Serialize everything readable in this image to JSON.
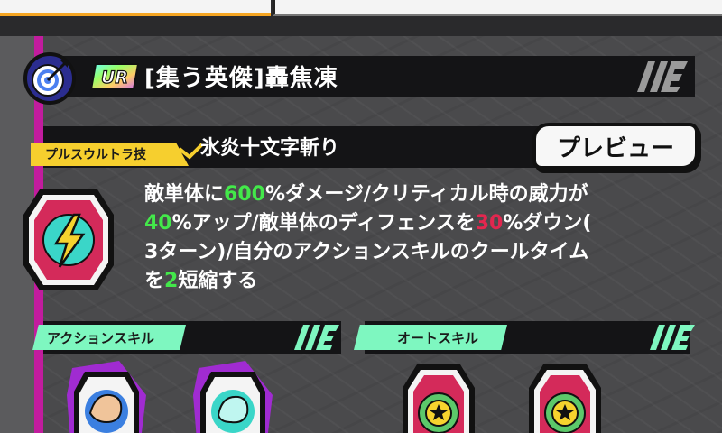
{
  "header": {
    "rarity_badge": "UR",
    "skill_title": "[集う英傑]轟焦凍",
    "icon": "target-icon"
  },
  "ultra_skill": {
    "label": "プルスウルトラ技",
    "name": "氷炎十文字斬り",
    "preview_label": "プレビュー",
    "icon": "lightning-icon",
    "description": {
      "l1_a": "敵単体に",
      "l1_b": "600",
      "l1_c": "%ダメージ/クリティカル時の威力が",
      "l2_a": "40",
      "l2_b": "%アップ/敵単体のディフェンスを",
      "l2_c": "30",
      "l2_d": "%ダウン(",
      "l3": "3ターン)/自分のアクションスキルのクールタイム",
      "l4_a": "を",
      "l4_b": "2",
      "l4_c": "短縮する"
    }
  },
  "action_skill": {
    "label": "アクションスキル",
    "icons": [
      "fist-icon",
      "ice-fist-icon"
    ]
  },
  "auto_skill": {
    "label": "オートスキル",
    "icons": [
      "star-gear-icon",
      "star-gear-icon"
    ]
  },
  "colors": {
    "highlight_green": "#43e84a",
    "highlight_red": "#e2274f",
    "ultra_yellow": "#f6cf2e",
    "section_mint": "#7ef7c0",
    "side_magenta": "#c21c9e"
  }
}
